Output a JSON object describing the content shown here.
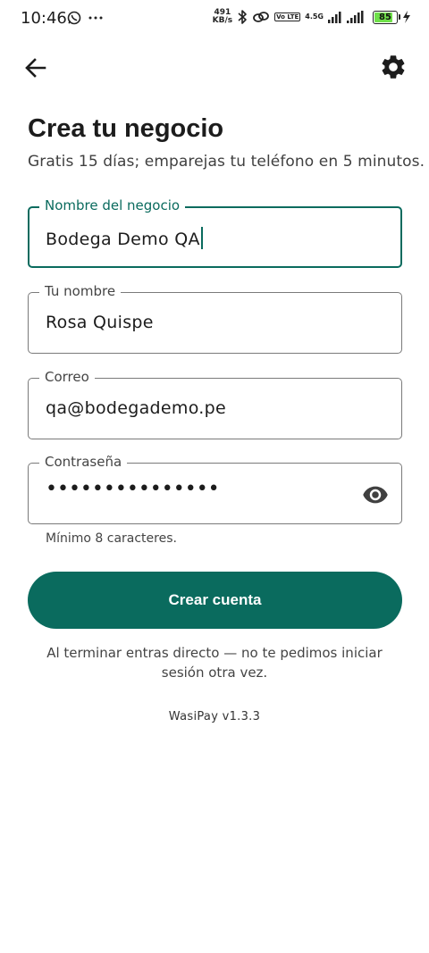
{
  "status_bar": {
    "time": "10:46",
    "net_speed_value": "491",
    "net_speed_unit": "KB/s",
    "volte_badge": "Vo LTE",
    "network_type": "4.5G",
    "battery_level": "85",
    "battery_fraction": 0.85,
    "icons": [
      "whatsapp-icon",
      "more-icon",
      "bluetooth-icon",
      "link-icon",
      "signal-icon",
      "charging-icon"
    ]
  },
  "toolbar": {
    "back_icon": "arrow-back-icon",
    "settings_icon": "gear-icon"
  },
  "header": {
    "title": "Crea tu negocio",
    "subtitle": "Gratis 15 días; emparejas tu teléfono en 5 minutos."
  },
  "form": {
    "business_name": {
      "label": "Nombre del negocio",
      "value": "Bodega Demo QA"
    },
    "your_name": {
      "label": "Tu nombre",
      "value": "Rosa Quispe"
    },
    "email": {
      "label": "Correo",
      "value": "qa@bodegademo.pe"
    },
    "password": {
      "label": "Contraseña",
      "value": "•••••••••••••••",
      "helper": "Mínimo 8 caracteres."
    }
  },
  "actions": {
    "create_account_label": "Crear cuenta"
  },
  "note": "Al terminar entras directo — no te pedimos iniciar sesión otra vez.",
  "version": "WasiPay v1.3.3",
  "colors": {
    "accent": "#0a6b5e",
    "battery": "#6fe04a"
  }
}
